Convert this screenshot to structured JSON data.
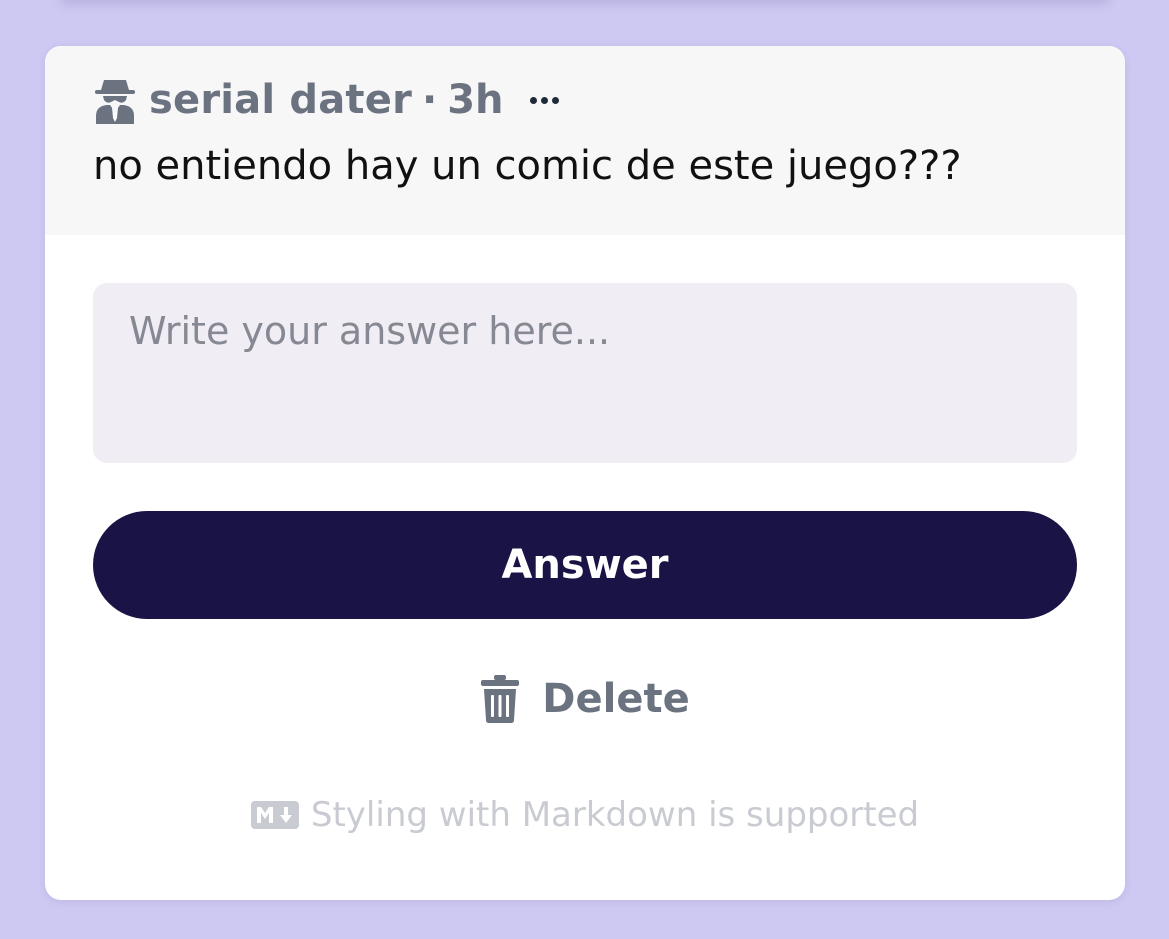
{
  "post": {
    "author": "serial dater",
    "separator": "·",
    "time_ago": "3h",
    "author_icon": "spy-icon",
    "more_icon": "more-dots-icon",
    "question": "no entiendo hay un comic de este juego???"
  },
  "answer_form": {
    "placeholder": "Write your answer here...",
    "value": "",
    "submit_label": "Answer",
    "delete_label": "Delete",
    "delete_icon": "trash-icon"
  },
  "footer": {
    "markdown_icon": "markdown-icon",
    "note": "Styling with Markdown is supported"
  },
  "colors": {
    "background": "#cdc9f2",
    "card": "#ffffff",
    "header": "#f7f7f8",
    "input": "#f0edf4",
    "primary_button": "#1a1446",
    "muted_text": "#6b7280",
    "faint_text": "#c9cbd2"
  }
}
